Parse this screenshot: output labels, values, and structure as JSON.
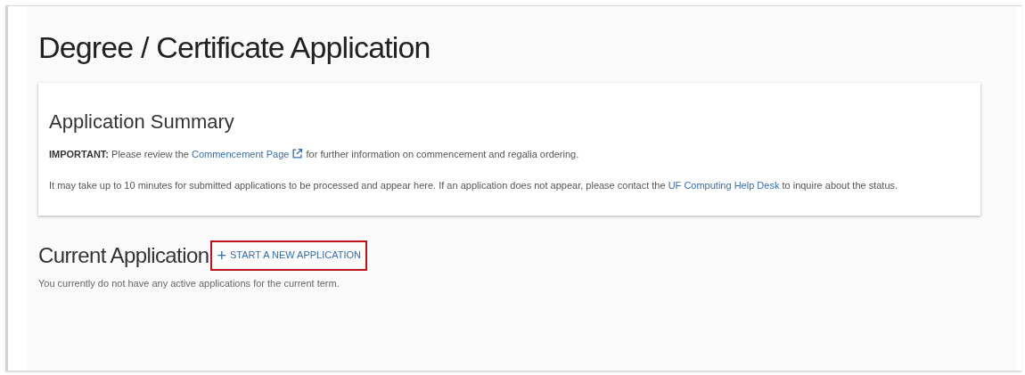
{
  "page_title": "Degree / Certificate Application",
  "summary": {
    "heading": "Application Summary",
    "notice": {
      "label": "IMPORTANT:",
      "before": "Please review the",
      "link": "Commencement Page",
      "after": "for further information on commencement and regalia ordering."
    },
    "processing": {
      "before": "It may take up to 10 minutes for submitted applications to be processed and appear here. If an application does not appear, please contact the",
      "link": "UF Computing Help Desk",
      "after": "to inquire about the status."
    }
  },
  "current": {
    "heading": "Current Application",
    "button": {
      "icon": "+",
      "label": "START A NEW APPLICATION",
      "highlighted": true
    },
    "message": "You currently do not have any active applications for the current term."
  }
}
